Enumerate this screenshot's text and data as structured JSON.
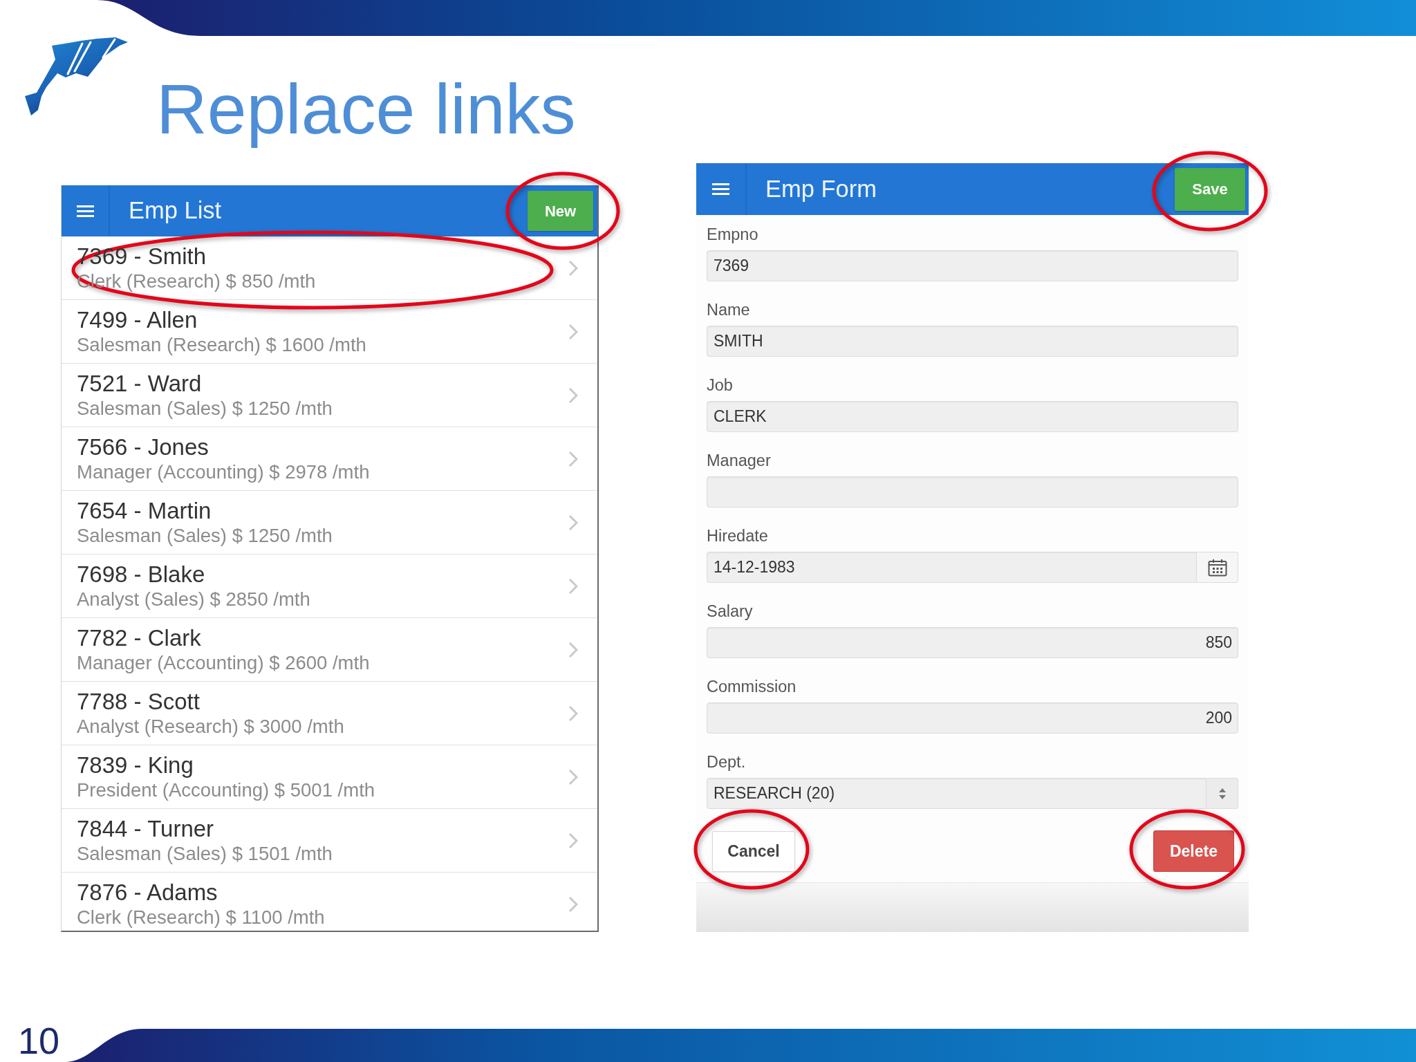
{
  "slide": {
    "title": "Replace links",
    "page_number": "10"
  },
  "emp_list": {
    "title": "Emp List",
    "new_button": {
      "label": "New",
      "circled": true
    },
    "rows": [
      {
        "title": "7369 - Smith",
        "subtitle": "Clerk (Research) $ 850 /mth",
        "circled": true
      },
      {
        "title": "7499 - Allen",
        "subtitle": "Salesman (Research) $ 1600 /mth",
        "circled": false
      },
      {
        "title": "7521 - Ward",
        "subtitle": "Salesman (Sales) $ 1250 /mth",
        "circled": false
      },
      {
        "title": "7566 - Jones",
        "subtitle": "Manager (Accounting) $ 2978 /mth",
        "circled": false
      },
      {
        "title": "7654 - Martin",
        "subtitle": "Salesman (Sales) $ 1250 /mth",
        "circled": false
      },
      {
        "title": "7698 - Blake",
        "subtitle": "Analyst (Sales) $ 2850 /mth",
        "circled": false
      },
      {
        "title": "7782 - Clark",
        "subtitle": "Manager (Accounting) $ 2600 /mth",
        "circled": false
      },
      {
        "title": "7788 - Scott",
        "subtitle": "Analyst (Research) $ 3000 /mth",
        "circled": false
      },
      {
        "title": "7839 - King",
        "subtitle": "President (Accounting) $ 5001 /mth",
        "circled": false
      },
      {
        "title": "7844 - Turner",
        "subtitle": "Salesman (Sales) $ 1501 /mth",
        "circled": false
      },
      {
        "title": "7876 - Adams",
        "subtitle": "Clerk (Research) $ 1100 /mth",
        "circled": false
      }
    ]
  },
  "emp_form": {
    "title": "Emp Form",
    "save_button": {
      "label": "Save",
      "circled": true
    },
    "fields": [
      {
        "kind": "text",
        "label": "Empno",
        "value": "7369"
      },
      {
        "kind": "text",
        "label": "Name",
        "value": "SMITH"
      },
      {
        "kind": "text",
        "label": "Job",
        "value": "CLERK"
      },
      {
        "kind": "text",
        "label": "Manager"
      },
      {
        "kind": "date",
        "label": "Hiredate",
        "value": "14-12-1983"
      },
      {
        "kind": "number",
        "label": "Salary",
        "value": "850"
      },
      {
        "kind": "number",
        "label": "Commission",
        "value": "200"
      },
      {
        "kind": "select",
        "label": "Dept.",
        "value": "RESEARCH (20)"
      }
    ],
    "buttons": [
      {
        "kind": "default",
        "label": "Cancel",
        "circled": true
      },
      {
        "kind": "danger",
        "label": "Delete",
        "circled": true
      }
    ]
  }
}
